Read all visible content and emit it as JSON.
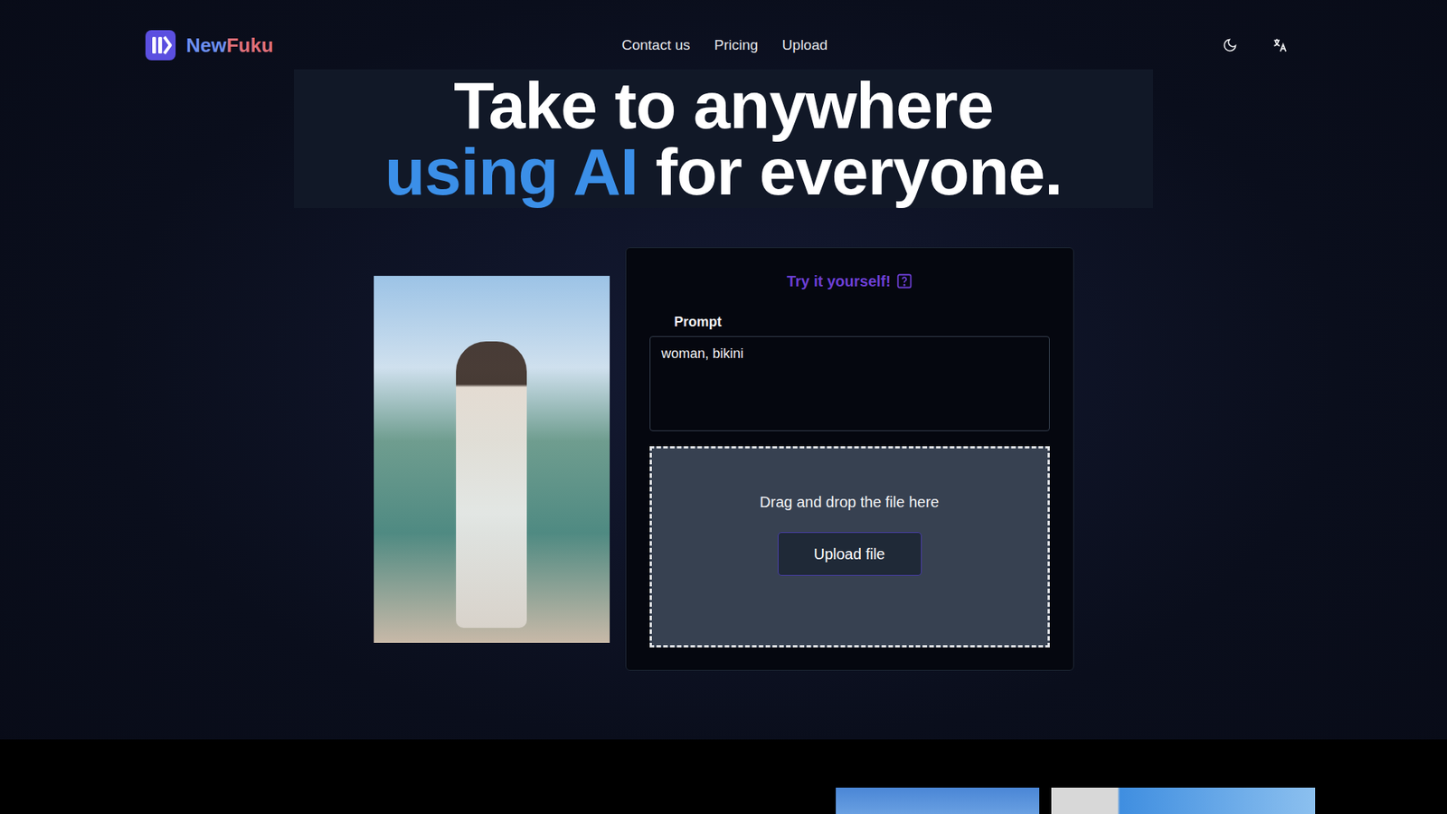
{
  "header": {
    "brand": {
      "first": "New",
      "second": "Fuku"
    },
    "nav": [
      "Contact us",
      "Pricing",
      "Upload"
    ]
  },
  "hero": {
    "line1": "Take to anywhere",
    "highlight": "using AI",
    "rest": "for everyone."
  },
  "try_card": {
    "title": "Try it yourself!",
    "prompt_label": "Prompt",
    "prompt_value": "woman, bikini",
    "dropzone": {
      "text": "Drag and drop the file here",
      "button": "Upload file"
    }
  }
}
